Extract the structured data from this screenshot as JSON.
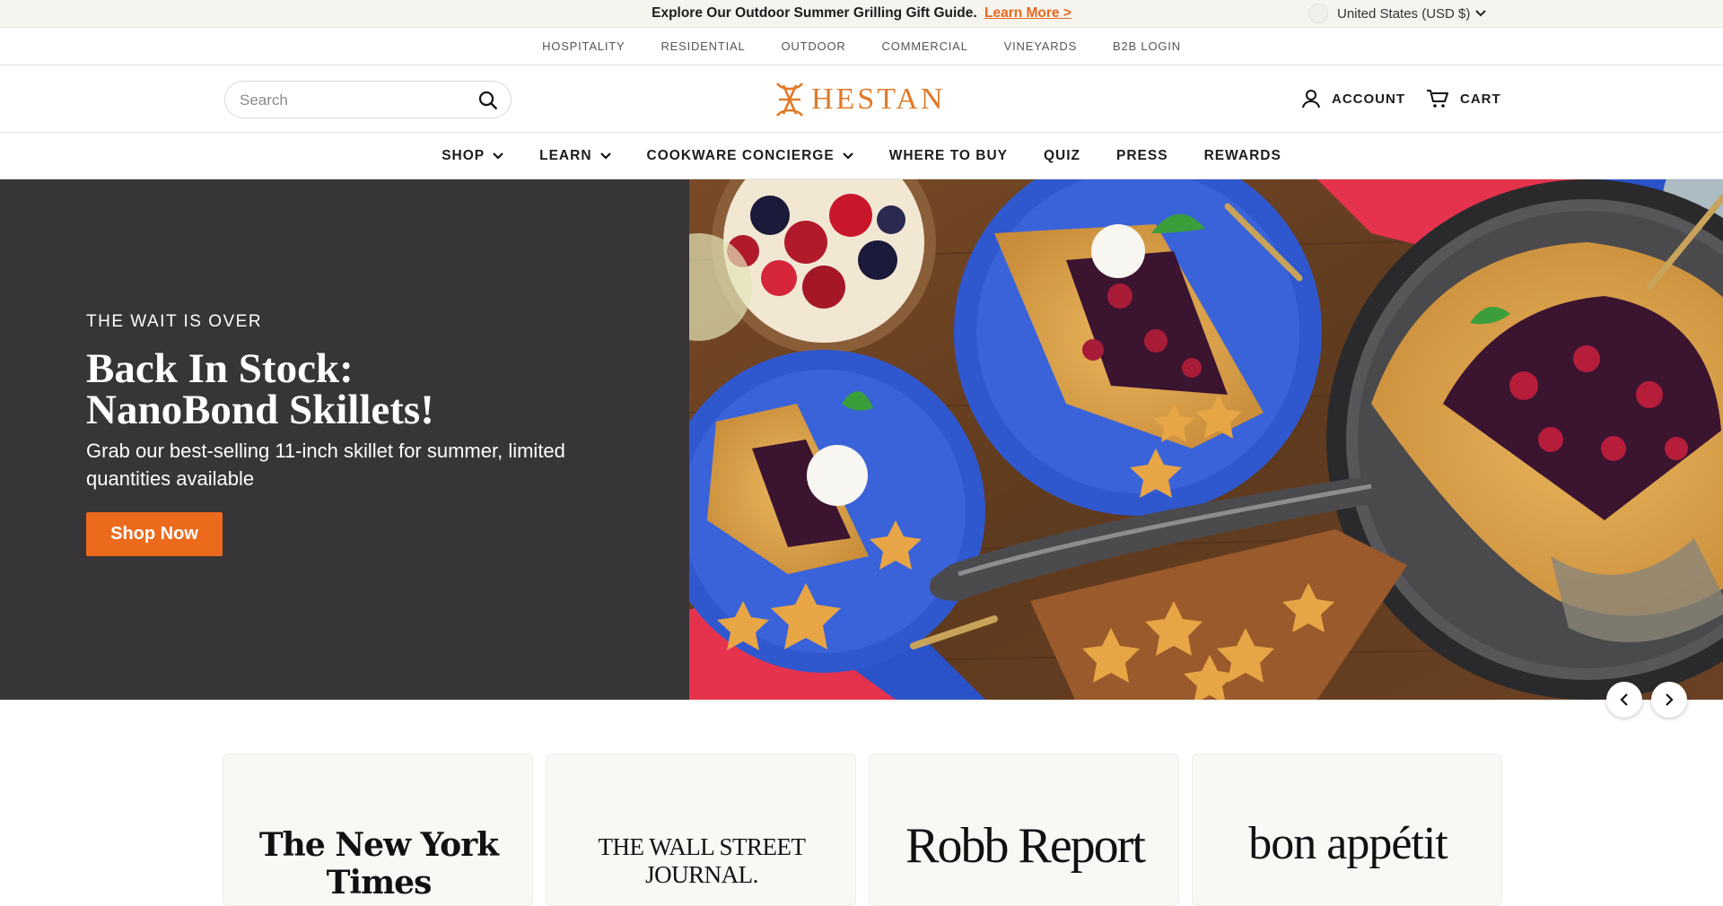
{
  "announcement": {
    "text": "Explore Our Outdoor Summer Grilling Gift Guide.",
    "link": "Learn More >",
    "locale": "United States (USD $)"
  },
  "utility_nav": [
    "HOSPITALITY",
    "RESIDENTIAL",
    "OUTDOOR",
    "COMMERCIAL",
    "VINEYARDS",
    "B2B LOGIN"
  ],
  "header": {
    "search_placeholder": "Search",
    "logo": "HESTAN",
    "account_label": "ACCOUNT",
    "cart_label": "CART"
  },
  "main_nav": [
    {
      "label": "SHOP",
      "dropdown": true
    },
    {
      "label": "LEARN",
      "dropdown": true
    },
    {
      "label": "COOKWARE CONCIERGE",
      "dropdown": true
    },
    {
      "label": "WHERE TO BUY",
      "dropdown": false
    },
    {
      "label": "QUIZ",
      "dropdown": false
    },
    {
      "label": "PRESS",
      "dropdown": false
    },
    {
      "label": "REWARDS",
      "dropdown": false
    }
  ],
  "hero": {
    "eyebrow": "THE WAIT IS OVER",
    "headline_1": "Back In Stock:",
    "headline_2": "NanoBond Skillets!",
    "subhead": "Grab our best-selling 11-inch skillet for summer, limited quantities available",
    "cta": "Shop Now"
  },
  "press": [
    "The New York Times",
    "THE WALL STREET JOURNAL.",
    "Robb Report",
    "bon appétit"
  ],
  "colors": {
    "accent": "#ec6a1c",
    "hero_panel": "#373537",
    "logo": "#e07a2a",
    "announce_bg": "#f5f4ef"
  }
}
